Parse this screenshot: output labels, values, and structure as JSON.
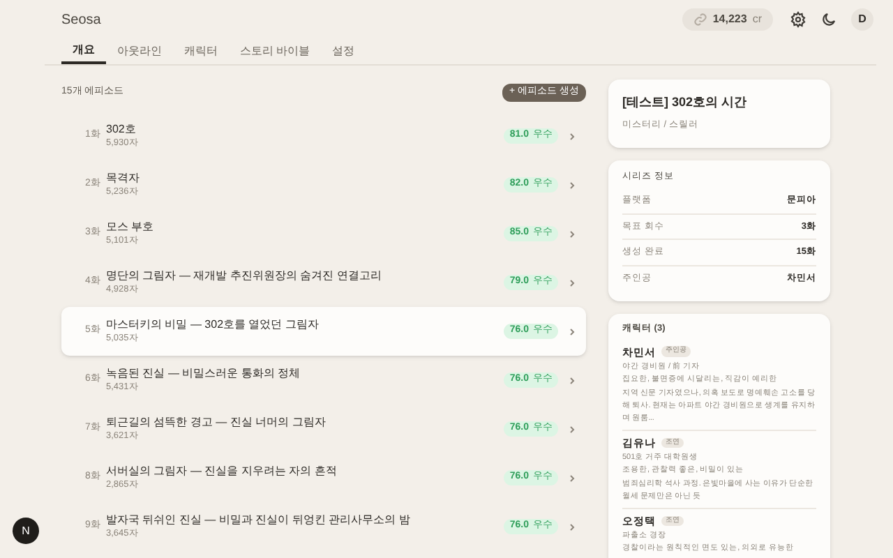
{
  "app": {
    "title": "Seosa",
    "credits": "14,223",
    "credits_unit": "cr",
    "avatar": "D"
  },
  "tabs": [
    {
      "label": "개요",
      "selected": true
    },
    {
      "label": "아웃라인",
      "selected": false
    },
    {
      "label": "캐릭터",
      "selected": false
    },
    {
      "label": "스토리 바이블",
      "selected": false
    },
    {
      "label": "설정",
      "selected": false
    }
  ],
  "episodes": {
    "count": "15개 에피소드",
    "create_button": "+ 에피소드 생성",
    "items": [
      {
        "number": "1화",
        "title": "302호",
        "length": "5,930자",
        "score": "81.0",
        "grade": "우수",
        "selected": false
      },
      {
        "number": "2화",
        "title": "목격자",
        "length": "5,236자",
        "score": "82.0",
        "grade": "우수",
        "selected": false
      },
      {
        "number": "3화",
        "title": "모스 부호",
        "length": "5,101자",
        "score": "85.0",
        "grade": "우수",
        "selected": false
      },
      {
        "number": "4화",
        "title": "명단의 그림자 — 재개발 추진위원장의 숨겨진 연결고리",
        "length": "4,928자",
        "score": "79.0",
        "grade": "우수",
        "selected": false
      },
      {
        "number": "5화",
        "title": "마스터키의 비밀 — 302호를 열었던 그림자",
        "length": "5,035자",
        "score": "76.0",
        "grade": "우수",
        "selected": true
      },
      {
        "number": "6화",
        "title": "녹음된 진실 — 비밀스러운 통화의 정체",
        "length": "5,431자",
        "score": "76.0",
        "grade": "우수",
        "selected": false
      },
      {
        "number": "7화",
        "title": "퇴근길의 섬뜩한 경고 — 진실 너머의 그림자",
        "length": "3,621자",
        "score": "76.0",
        "grade": "우수",
        "selected": false
      },
      {
        "number": "8화",
        "title": "서버실의 그림자 — 진실을 지우려는 자의 흔적",
        "length": "2,865자",
        "score": "76.0",
        "grade": "우수",
        "selected": false
      },
      {
        "number": "9화",
        "title": "발자국 뒤쉬인 진실 — 비밀과 진실이 뒤엉킨 관리사무소의 밤",
        "length": "3,645자",
        "score": "76.0",
        "grade": "우수",
        "selected": false
      }
    ]
  },
  "series": {
    "title": "[테스트] 302호의 시간",
    "genre": "미스터리 / 스릴러"
  },
  "series_info": {
    "heading": "시리즈 정보",
    "rows": [
      {
        "label": "플랫폼",
        "value": "문피아"
      },
      {
        "label": "목표 회수",
        "value": "3화"
      },
      {
        "label": "생성 완료",
        "value": "15화"
      },
      {
        "label": "주인공",
        "value": "차민서"
      }
    ]
  },
  "characters": {
    "heading": "캐릭터 (3)",
    "items": [
      {
        "name": "차민서",
        "role": "주인공",
        "job": "야간 경비원 / 前 기자",
        "traits": "집요한, 불면증에 시달리는, 직감이 예리한",
        "bio": "지역 신문 기자였으나, 의혹 보도로 명예훼손 고소를 당해 퇴사. 현재는 아파트 야간 경비원으로 생계를 유지하며 원룸..."
      },
      {
        "name": "김유나",
        "role": "조연",
        "job": "501호 거주 대학원생",
        "traits": "조용한, 관찰력 좋은, 비밀이 있는",
        "bio": "범죄심리학 석사 과정. 은빛마을에 사는 이유가 단순한 월세 문제만은 아닌 듯"
      },
      {
        "name": "오정택",
        "role": "조연",
        "job": "파출소 경장",
        "traits": "경찰이라는 원칙적인 면도 있는, 의외로 유능한"
      }
    ]
  },
  "help_button": "N"
}
